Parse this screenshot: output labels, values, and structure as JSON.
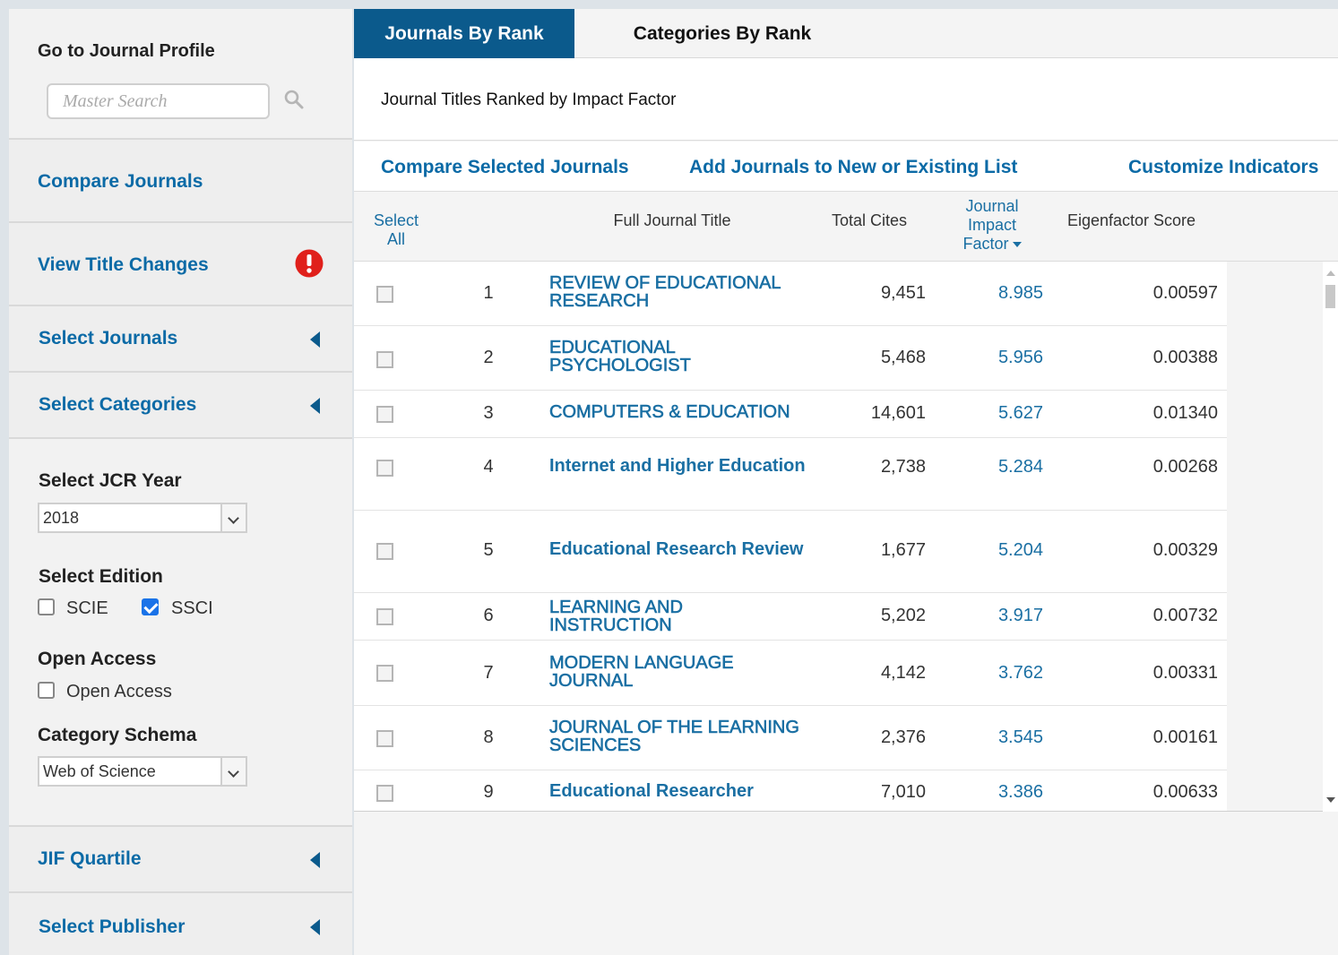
{
  "sidebar": {
    "journal_profile_heading": "Go to Journal Profile",
    "search_placeholder": "Master Search",
    "compare_journals": "Compare Journals",
    "view_title_changes": "View Title Changes",
    "select_journals": "Select Journals",
    "select_categories": "Select Categories",
    "jcr_year_heading": "Select JCR Year",
    "jcr_year_value": "2018",
    "edition_heading": "Select Edition",
    "edition_scie": "SCIE",
    "edition_scie_checked": false,
    "edition_ssci": "SSCI",
    "edition_ssci_checked": true,
    "open_access_heading": "Open Access",
    "open_access_label": "Open Access",
    "category_schema_heading": "Category Schema",
    "category_schema_value": "Web of Science",
    "jif_quartile": "JIF Quartile",
    "select_publisher": "Select Publisher"
  },
  "tabs": {
    "journals_by_rank": "Journals By Rank",
    "categories_by_rank": "Categories By Rank"
  },
  "ranked_title": "Journal Titles Ranked by Impact Factor",
  "actions": {
    "compare_selected": "Compare Selected Journals",
    "add_to_list": "Add Journals to New or Existing List",
    "customize": "Customize Indicators"
  },
  "table": {
    "headers": {
      "select_all_1": "Select",
      "select_all_2": "All",
      "title": "Full Journal Title",
      "cites": "Total Cites",
      "jif_1": "Journal",
      "jif_2": "Impact",
      "jif_3": "Factor",
      "eigen": "Eigenfactor Score"
    },
    "rows": [
      {
        "rank": "1",
        "title_1": "REVIEW OF EDUCATIONAL",
        "title_2": "RESEARCH",
        "cites": "9,451",
        "jif": "8.985",
        "eigen": "0.00597"
      },
      {
        "rank": "2",
        "title_1": "EDUCATIONAL",
        "title_2": "PSYCHOLOGIST",
        "cites": "5,468",
        "jif": "5.956",
        "eigen": "0.00388"
      },
      {
        "rank": "3",
        "title_1": "COMPUTERS & EDUCATION",
        "title_2": "",
        "cites": "14,601",
        "jif": "5.627",
        "eigen": "0.01340"
      },
      {
        "rank": "4",
        "title_1": "Internet and Higher Education",
        "title_2": "",
        "cites": "2,738",
        "jif": "5.284",
        "eigen": "0.00268"
      },
      {
        "rank": "5",
        "title_1": "Educational Research Review",
        "title_2": "",
        "cites": "1,677",
        "jif": "5.204",
        "eigen": "0.00329"
      },
      {
        "rank": "6",
        "title_1": "LEARNING AND",
        "title_2": "INSTRUCTION",
        "cites": "5,202",
        "jif": "3.917",
        "eigen": "0.00732"
      },
      {
        "rank": "7",
        "title_1": "MODERN LANGUAGE",
        "title_2": "JOURNAL",
        "cites": "4,142",
        "jif": "3.762",
        "eigen": "0.00331"
      },
      {
        "rank": "8",
        "title_1": "JOURNAL OF THE LEARNING",
        "title_2": "SCIENCES",
        "cites": "2,376",
        "jif": "3.545",
        "eigen": "0.00161"
      },
      {
        "rank": "9",
        "title_1": "Educational Researcher",
        "title_2": "",
        "cites": "7,010",
        "jif": "3.386",
        "eigen": "0.00633"
      }
    ]
  },
  "colors": {
    "accent": "#0b5a8c",
    "link": "#0b6aa6",
    "alert": "#e0201b"
  },
  "icons": [
    "search-icon",
    "alert-icon",
    "collapse-arrow-icon",
    "chevron-down-icon",
    "sort-down-icon"
  ]
}
